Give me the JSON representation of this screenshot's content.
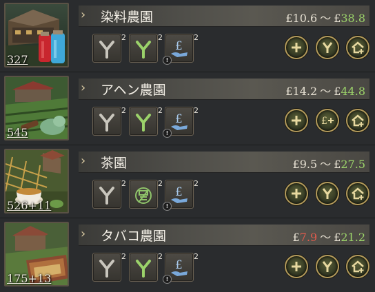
{
  "rows": [
    {
      "name": "染料農園",
      "count": "327",
      "price": {
        "currency": "£",
        "min": "10.6",
        "max": "38.8",
        "min_color": "#e6e0d2",
        "max_color": "#9cd46a"
      },
      "buttons": [
        {
          "icon": "branch-grey-icon",
          "level": "2"
        },
        {
          "icon": "branch-green-icon",
          "level": "2"
        },
        {
          "icon": "hand-pound-icon",
          "level": "2"
        }
      ],
      "actions": [
        "plus-icon",
        "branch-icon",
        "house-plus-icon"
      ]
    },
    {
      "name": "アヘン農園",
      "count": "545",
      "price": {
        "currency": "£",
        "min": "14.2",
        "max": "44.8",
        "min_color": "#e6e0d2",
        "max_color": "#9cd46a"
      },
      "buttons": [
        {
          "icon": "branch-grey-icon",
          "level": "2"
        },
        {
          "icon": "branch-green-icon",
          "level": "2"
        },
        {
          "icon": "hand-pound-icon",
          "level": "2"
        }
      ],
      "actions": [
        "plus-icon",
        "pound-plus-icon",
        "house-plus-icon"
      ]
    },
    {
      "name": "茶園",
      "count": "526+11",
      "price": {
        "currency": "£",
        "min": "9.5",
        "max": "27.5",
        "min_color": "#e6e0d2",
        "max_color": "#9cd46a"
      },
      "buttons": [
        {
          "icon": "branch-grey-icon",
          "level": "2"
        },
        {
          "icon": "law-stamp-icon",
          "level": "2"
        },
        {
          "icon": "hand-pound-icon",
          "level": "2"
        }
      ],
      "actions": [
        "plus-icon",
        "branch-icon",
        "house-plus-icon"
      ]
    },
    {
      "name": "タバコ農園",
      "count": "175+13",
      "price": {
        "currency": "£",
        "min": "7.9",
        "max": "21.2",
        "min_color": "#e05b4d",
        "max_color": "#9cd46a"
      },
      "buttons": [
        {
          "icon": "branch-grey-icon",
          "level": "2"
        },
        {
          "icon": "branch-green-icon",
          "level": "2"
        },
        {
          "icon": "hand-pound-icon",
          "level": "2"
        }
      ],
      "actions": [
        "plus-icon",
        "branch-icon",
        "house-plus-icon"
      ]
    }
  ],
  "tilde": "～",
  "warn_glyph": "!",
  "chevron_glyph": "›"
}
